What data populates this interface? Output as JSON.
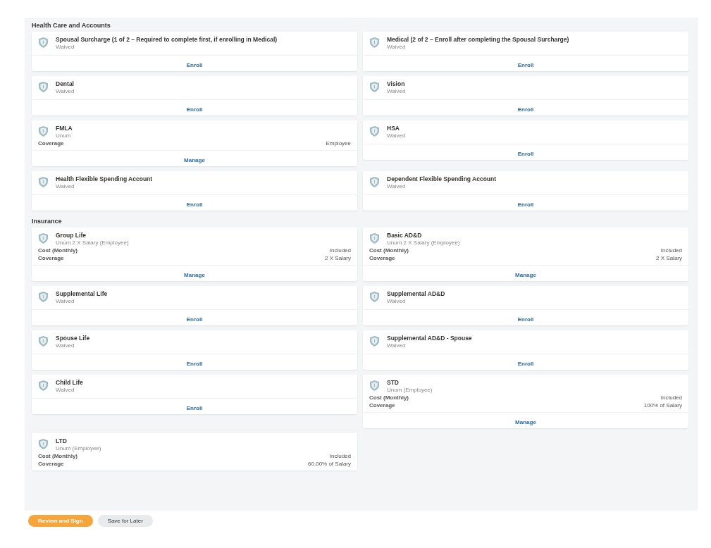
{
  "sections": [
    {
      "title": "Health Care and Accounts",
      "cards": [
        {
          "title": "Spousal Surcharge (1 of 2 – Required to complete first, if enrolling in Medical)",
          "subtitle": "Waived",
          "action": "Enroll"
        },
        {
          "title": "Medical (2 of 2 – Enroll after completing the Spousal Surcharge)",
          "subtitle": "Waived",
          "action": "Enroll"
        },
        {
          "title": "Dental",
          "subtitle": "Waived",
          "action": "Enroll"
        },
        {
          "title": "Vision",
          "subtitle": "Waived",
          "action": "Enroll"
        },
        {
          "title": "FMLA",
          "subtitle": "Unum",
          "details": [
            {
              "label": "Coverage",
              "value": "Employee"
            }
          ],
          "action": "Manage"
        },
        {
          "title": "HSA",
          "subtitle": "Waived",
          "action": "Enroll"
        },
        {
          "title": "Health Flexible Spending Account",
          "subtitle": "Waived",
          "action": "Enroll"
        },
        {
          "title": "Dependent Flexible Spending Account",
          "subtitle": "Waived",
          "action": "Enroll"
        }
      ]
    },
    {
      "title": "Insurance",
      "cards": [
        {
          "title": "Group Life",
          "subtitle": "Unum 2 X Salary (Employee)",
          "details": [
            {
              "label": "Cost (Monthly)",
              "value": "Included"
            },
            {
              "label": "Coverage",
              "value": "2 X Salary"
            }
          ],
          "action": "Manage"
        },
        {
          "title": "Basic AD&D",
          "subtitle": "Unum 2 X Salary (Employee)",
          "details": [
            {
              "label": "Cost (Monthly)",
              "value": "Included"
            },
            {
              "label": "Coverage",
              "value": "2 X Salary"
            }
          ],
          "action": "Manage"
        },
        {
          "title": "Supplemental Life",
          "subtitle": "Waived",
          "action": "Enroll"
        },
        {
          "title": "Supplemental AD&D",
          "subtitle": "Waived",
          "action": "Enroll"
        },
        {
          "title": "Spouse Life",
          "subtitle": "Waived",
          "action": "Enroll"
        },
        {
          "title": "Supplemental AD&D - Spouse",
          "subtitle": "Waived",
          "action": "Enroll"
        },
        {
          "title": "Child Life",
          "subtitle": "Waived",
          "action": "Enroll"
        },
        {
          "title": "STD",
          "subtitle": "Unum (Employee)",
          "details": [
            {
              "label": "Cost (Monthly)",
              "value": "Included"
            },
            {
              "label": "Coverage",
              "value": "100% of Salary"
            }
          ],
          "action": "Manage"
        },
        {
          "title": "LTD",
          "subtitle": "Unum (Employee)",
          "details": [
            {
              "label": "Cost (Monthly)",
              "value": "Included"
            },
            {
              "label": "Coverage",
              "value": "60.00% of Salary"
            }
          ]
        }
      ]
    }
  ],
  "buttons": [
    {
      "label": "Review and Sign",
      "kind": "primary"
    },
    {
      "label": "Save for Later",
      "kind": "secondary"
    }
  ]
}
